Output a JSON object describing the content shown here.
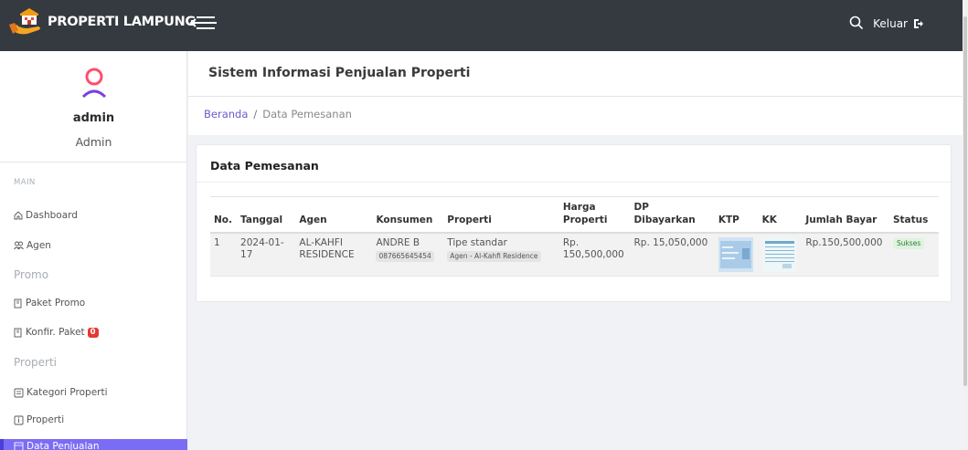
{
  "brand": {
    "title": "PROPERTI LAMPUNG"
  },
  "topbar": {
    "logout_label": "Keluar"
  },
  "sidebar": {
    "user_name": "admin",
    "user_role": "Admin",
    "section_main": "MAIN",
    "items": [
      {
        "label": "Dashboard"
      },
      {
        "label": "Agen"
      },
      {
        "label": "Promo"
      },
      {
        "label": "Paket Promo"
      },
      {
        "label": "Konfir. Paket"
      },
      {
        "label": "Properti"
      },
      {
        "label": "Kategori Properti"
      },
      {
        "label": "Properti"
      },
      {
        "label": "Data Penjualan"
      }
    ],
    "konfir_badge": "0"
  },
  "header": {
    "title": "Sistem Informasi Penjualan Properti",
    "breadcrumb_home": "Beranda",
    "breadcrumb_sep": "/",
    "breadcrumb_current": "Data Pemesanan"
  },
  "card": {
    "title": "Data Pemesanan"
  },
  "table": {
    "headers": [
      "No.",
      "Tanggal",
      "Agen",
      "Konsumen",
      "Properti",
      "Harga Properti",
      "DP Dibayarkan",
      "KTP",
      "KK",
      "Jumlah Bayar",
      "Status"
    ],
    "rows": [
      {
        "no": "1",
        "tanggal": "2024-01-17",
        "agen": "AL-KAHFI RESIDENCE",
        "konsumen": "ANDRE B",
        "konsumen_phone": "087665645454",
        "properti": "Tipe standar",
        "properti_tag": "Agen - Al-Kahfi Residence",
        "harga": "Rp. 150,500,000",
        "dp": "Rp. 15,050,000",
        "jumlah": "Rp.150,500,000",
        "status": "Sukses"
      }
    ]
  },
  "colors": {
    "topbar": "#343a40",
    "accent": "#7b6cf6",
    "link": "#6a5acd",
    "badge": "#e53935",
    "success_bg": "#dff3df"
  }
}
